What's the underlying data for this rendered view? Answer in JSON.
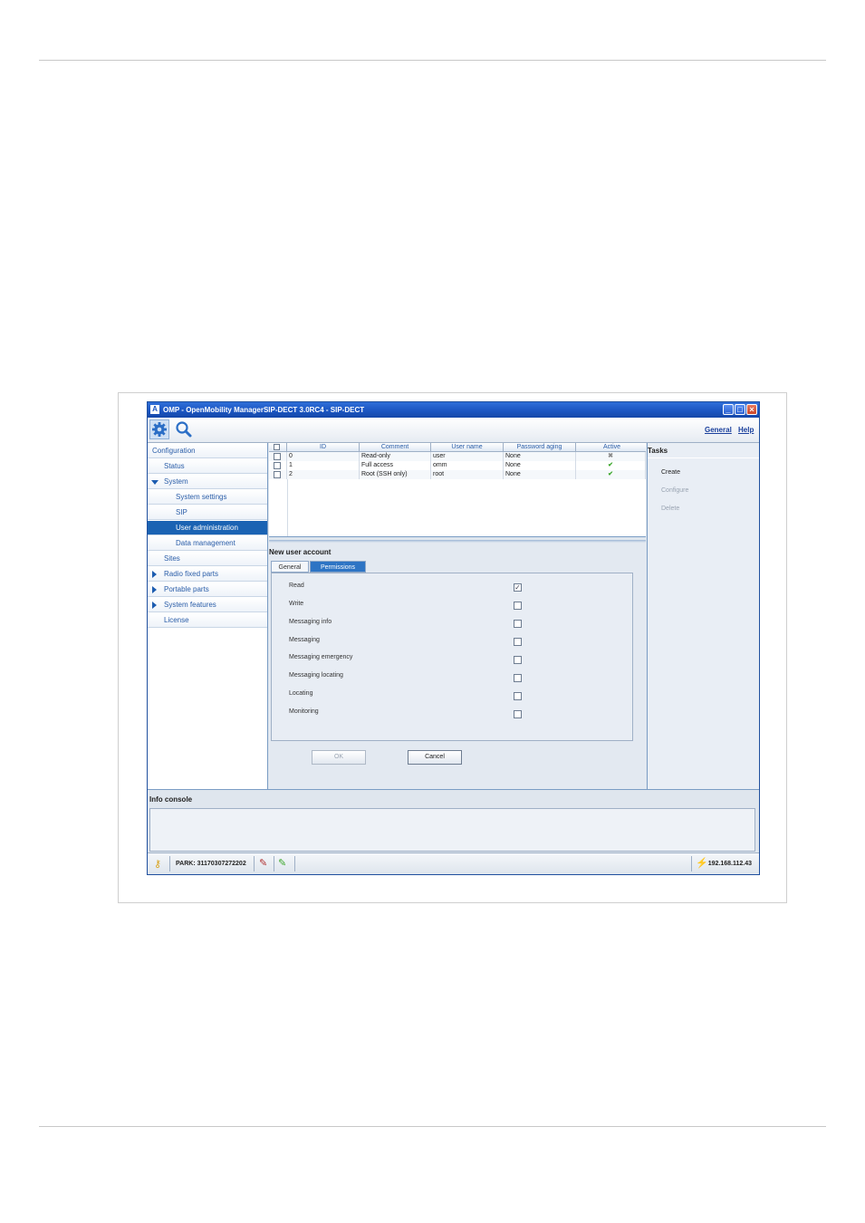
{
  "window": {
    "title": "OMP - OpenMobility ManagerSIP-DECT 3.0RC4 - SIP-DECT",
    "app_icon_glyph": "A",
    "controls": [
      "minimize",
      "maximize",
      "close"
    ]
  },
  "toolbar": {
    "icons": [
      "gear-icon",
      "search-icon"
    ],
    "general_link": "General",
    "help_link": "Help"
  },
  "nav": {
    "items": [
      {
        "label": "Configuration",
        "level": 0,
        "arrow": "none"
      },
      {
        "label": "Status",
        "level": 1,
        "arrow": "none"
      },
      {
        "label": "System",
        "level": 1,
        "arrow": "expanded"
      },
      {
        "label": "System settings",
        "level": 2,
        "arrow": "none"
      },
      {
        "label": "SIP",
        "level": 2,
        "arrow": "none"
      },
      {
        "label": "User administration",
        "level": 2,
        "arrow": "none",
        "selected": true
      },
      {
        "label": "Data management",
        "level": 2,
        "arrow": "none"
      },
      {
        "label": "Sites",
        "level": 1,
        "arrow": "none"
      },
      {
        "label": "Radio fixed parts",
        "level": 1,
        "arrow": "collapsed"
      },
      {
        "label": "Portable parts",
        "level": 1,
        "arrow": "collapsed"
      },
      {
        "label": "System features",
        "level": 1,
        "arrow": "collapsed"
      },
      {
        "label": "License",
        "level": 1,
        "arrow": "none"
      }
    ]
  },
  "users_table": {
    "columns": [
      "ID",
      "Comment",
      "User name",
      "Password aging",
      "Active"
    ],
    "rows": [
      {
        "id": "0",
        "comment": "Read-only",
        "user_name": "user",
        "password_aging": "None",
        "active": "inactive"
      },
      {
        "id": "1",
        "comment": "Full access",
        "user_name": "omm",
        "password_aging": "None",
        "active": "active"
      },
      {
        "id": "2",
        "comment": "Root (SSH only)",
        "user_name": "root",
        "password_aging": "None",
        "active": "active"
      }
    ]
  },
  "form": {
    "title": "New user account",
    "tabs": [
      "General",
      "Permissions"
    ],
    "active_tab": "Permissions",
    "permissions": [
      {
        "label": "Read",
        "checked": true
      },
      {
        "label": "Write",
        "checked": false
      },
      {
        "label": "Messaging info",
        "checked": false
      },
      {
        "label": "Messaging",
        "checked": false
      },
      {
        "label": "Messaging emergency",
        "checked": false
      },
      {
        "label": "Messaging locating",
        "checked": false
      },
      {
        "label": "Locating",
        "checked": false
      },
      {
        "label": "Monitoring",
        "checked": false
      }
    ],
    "ok_label": "OK",
    "cancel_label": "Cancel"
  },
  "tasks": {
    "title": "Tasks",
    "items": [
      {
        "label": "Create",
        "enabled": true
      },
      {
        "label": "Configure",
        "enabled": false
      },
      {
        "label": "Delete",
        "enabled": false
      }
    ]
  },
  "info_console": {
    "title": "Info console"
  },
  "status_bar": {
    "park": "PARK: 31170307272202",
    "ip": "192.168.112.43"
  },
  "colors": {
    "title_bar": "#1a54c0",
    "selected_nav": "#1b63b3",
    "link": "#1a3f9c",
    "active_check": "#3aa62a",
    "inactive_cross": "#8a8a8a"
  }
}
